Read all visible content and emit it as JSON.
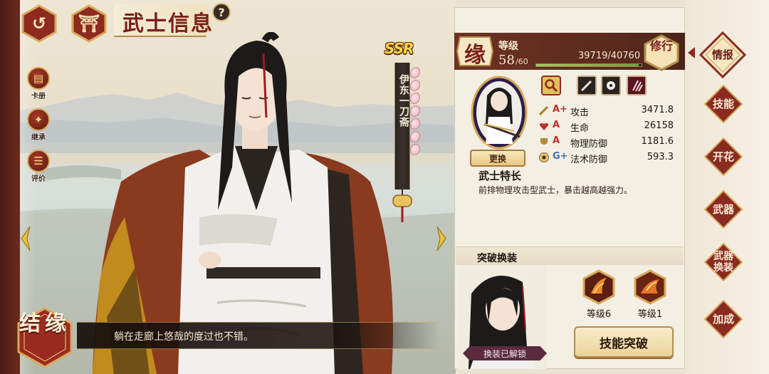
{
  "header": {
    "title": "武士信息",
    "help": "?"
  },
  "left_menu": [
    {
      "label": "卡册",
      "icon": "card-book-icon"
    },
    {
      "label": "继承",
      "icon": "inherit-star-icon"
    },
    {
      "label": "评价",
      "icon": "review-icon"
    }
  ],
  "character": {
    "rarity": "SSR",
    "name": "伊东一刀斋",
    "dialogue": "躺在走廊上悠哉的度过也不错。"
  },
  "bond_button": {
    "label": "结缘"
  },
  "level": {
    "badge": "缘",
    "label": "等级",
    "current": "58",
    "max": "/60",
    "exp": "39719/40760",
    "exp_progress": 0.974
  },
  "training_button": {
    "label": "修行"
  },
  "change_button": {
    "label": "更换"
  },
  "stats": [
    {
      "name": "攻击",
      "grade": "A+",
      "value": "3471.8"
    },
    {
      "name": "生命",
      "grade": "A",
      "value": "26158"
    },
    {
      "name": "物理防御",
      "grade": "A",
      "value": "1181.6"
    },
    {
      "name": "法术防御",
      "grade": "G+",
      "value": "593.3"
    }
  ],
  "trait": {
    "title": "武士特长",
    "desc": "前排物理攻击型武士，暴击越高越强力。"
  },
  "breakthrough": {
    "title": "突破换装",
    "unlock_status": "换装已解锁",
    "skills": [
      {
        "level": "等级6",
        "icon": "flame-slash-icon"
      },
      {
        "level": "等级1",
        "icon": "fire-wing-icon"
      }
    ],
    "button": "技能突破"
  },
  "tabs": [
    {
      "label": "情报",
      "active": true
    },
    {
      "label": "技能",
      "active": false
    },
    {
      "label": "开花",
      "active": false
    },
    {
      "label": "武器",
      "active": false
    },
    {
      "label": "武器换装",
      "active": false
    },
    {
      "label": "加成",
      "active": false
    }
  ],
  "colors": {
    "panel_bg": "#f4efe3",
    "accent_red": "#8a2b22",
    "gold": "#d7a95c",
    "exp_green": "#6ca43d"
  }
}
